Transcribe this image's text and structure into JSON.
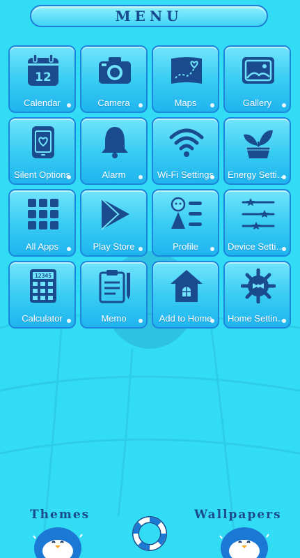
{
  "header": {
    "title": "MENU"
  },
  "tiles": [
    {
      "label": "Calendar",
      "icon": "calendar-icon",
      "day": "12"
    },
    {
      "label": "Camera",
      "icon": "camera-icon"
    },
    {
      "label": "Maps",
      "icon": "map-icon"
    },
    {
      "label": "Gallery",
      "icon": "gallery-icon"
    },
    {
      "label": "Silent Options",
      "icon": "silent-phone-icon"
    },
    {
      "label": "Alarm",
      "icon": "bell-icon"
    },
    {
      "label": "Wi-Fi Settings",
      "icon": "wifi-icon"
    },
    {
      "label": "Energy Settings",
      "icon": "plant-icon"
    },
    {
      "label": "All Apps",
      "icon": "apps-grid-icon"
    },
    {
      "label": "Play Store",
      "icon": "play-store-icon"
    },
    {
      "label": "Profile",
      "icon": "profile-icon"
    },
    {
      "label": "Device Settings",
      "icon": "sliders-icon"
    },
    {
      "label": "Calculator",
      "icon": "calculator-icon",
      "display": "12345"
    },
    {
      "label": "Memo",
      "icon": "memo-icon"
    },
    {
      "label": "Add to Home",
      "icon": "birdhouse-icon"
    },
    {
      "label": "Home Settings",
      "icon": "helm-gear-icon"
    }
  ],
  "footer": {
    "themes_label": "Themes",
    "wallpapers_label": "Wallpapers"
  },
  "colors": {
    "background": "#33dcf5",
    "icon": "#1a4b8f",
    "border": "#1c86dd"
  }
}
